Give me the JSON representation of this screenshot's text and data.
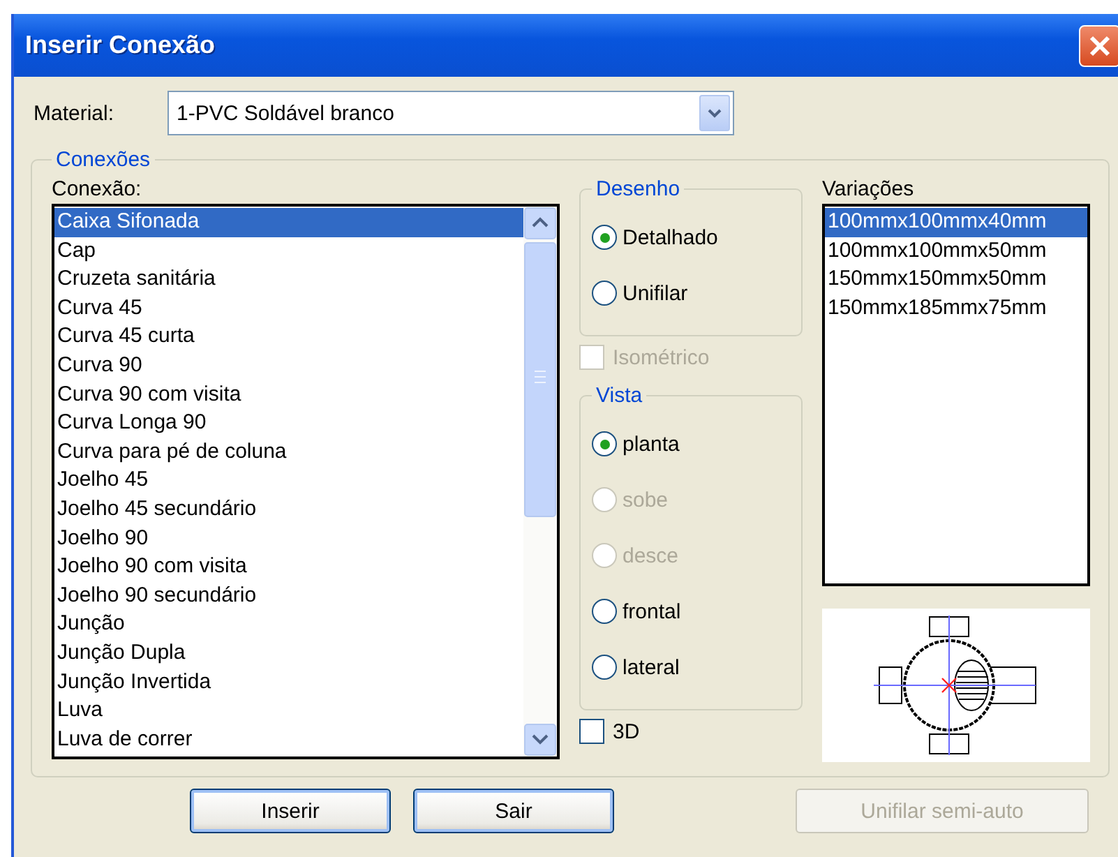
{
  "window": {
    "title": "Inserir Conexão"
  },
  "material": {
    "label": "Material:",
    "value": "1-PVC Soldável branco"
  },
  "connections": {
    "title": "Conexões",
    "list": {
      "label": "Conexão:",
      "items": [
        {
          "text": "Caixa Sifonada",
          "selected": true
        },
        {
          "text": "Cap",
          "selected": false
        },
        {
          "text": "Cruzeta sanitária",
          "selected": false
        },
        {
          "text": "Curva 45",
          "selected": false
        },
        {
          "text": "Curva 45 curta",
          "selected": false
        },
        {
          "text": "Curva 90",
          "selected": false
        },
        {
          "text": "Curva 90 com visita",
          "selected": false
        },
        {
          "text": "Curva Longa 90",
          "selected": false
        },
        {
          "text": "Curva para pé de coluna",
          "selected": false
        },
        {
          "text": "Joelho 45",
          "selected": false
        },
        {
          "text": "Joelho 45 secundário",
          "selected": false
        },
        {
          "text": "Joelho 90",
          "selected": false
        },
        {
          "text": "Joelho 90 com visita",
          "selected": false
        },
        {
          "text": "Joelho 90 secundário",
          "selected": false
        },
        {
          "text": "Junção",
          "selected": false
        },
        {
          "text": "Junção Dupla",
          "selected": false
        },
        {
          "text": "Junção Invertida",
          "selected": false
        },
        {
          "text": "Luva",
          "selected": false
        },
        {
          "text": "Luva de correr",
          "selected": false
        }
      ]
    },
    "drawing": {
      "title": "Desenho",
      "options": [
        {
          "label": "Detalhado",
          "selected": true,
          "disabled": false
        },
        {
          "label": "Unifilar",
          "selected": false,
          "disabled": false
        }
      ]
    },
    "isometric": {
      "label": "Isométrico",
      "checked": false,
      "disabled": true
    },
    "view": {
      "title": "Vista",
      "options": [
        {
          "label": "planta",
          "selected": true,
          "disabled": false
        },
        {
          "label": "sobe",
          "selected": false,
          "disabled": true
        },
        {
          "label": "desce",
          "selected": false,
          "disabled": true
        },
        {
          "label": "frontal",
          "selected": false,
          "disabled": false
        },
        {
          "label": "lateral",
          "selected": false,
          "disabled": false
        }
      ]
    },
    "three_d": {
      "label": "3D",
      "checked": false,
      "disabled": false
    },
    "variations": {
      "label": "Variações",
      "items": [
        {
          "text": "100mmx100mmx40mm",
          "selected": true
        },
        {
          "text": "100mmx100mmx50mm",
          "selected": false
        },
        {
          "text": "150mmx150mmx50mm",
          "selected": false
        },
        {
          "text": "150mmx185mmx75mm",
          "selected": false
        }
      ]
    }
  },
  "buttons": [
    {
      "label": "Inserir",
      "disabled": false
    },
    {
      "label": "Sair",
      "disabled": false
    },
    {
      "label": "Unifilar semi-auto",
      "disabled": true
    }
  ]
}
